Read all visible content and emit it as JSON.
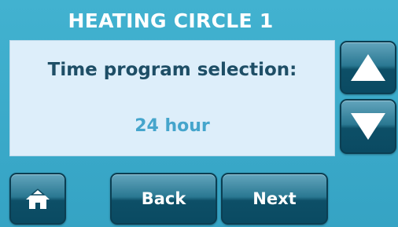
{
  "header": {
    "title": "HEATING CIRCLE 1"
  },
  "panel": {
    "prompt": "Time program selection:",
    "value": "24 hour"
  },
  "nav": {
    "back_label": "Back",
    "next_label": "Next",
    "home_icon": "home-icon",
    "up_icon": "arrow-up-icon",
    "down_icon": "arrow-down-icon"
  },
  "colors": {
    "background": "#3aa9c9",
    "panel": "#ddeefa",
    "prompt_text": "#1e4e66",
    "value_text": "#45a5cc",
    "button": "#0d4f67"
  }
}
